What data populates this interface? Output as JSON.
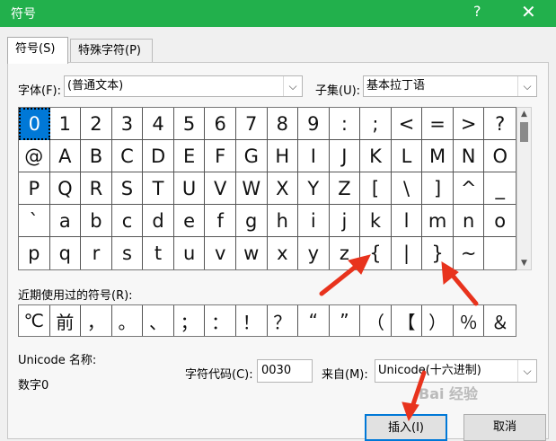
{
  "window": {
    "title": "符号",
    "help": "?",
    "close": "✕"
  },
  "tabs": [
    {
      "label": "符号(S)"
    },
    {
      "label": "特殊字符(P)"
    }
  ],
  "font": {
    "label": "字体(F):",
    "value": "(普通文本)"
  },
  "subset": {
    "label": "子集(U):",
    "value": "基本拉丁语"
  },
  "symbols": [
    "0",
    "1",
    "2",
    "3",
    "4",
    "5",
    "6",
    "7",
    "8",
    "9",
    ":",
    ";",
    "<",
    "=",
    ">",
    "?",
    "@",
    "A",
    "B",
    "C",
    "D",
    "E",
    "F",
    "G",
    "H",
    "I",
    "J",
    "K",
    "L",
    "M",
    "N",
    "O",
    "P",
    "Q",
    "R",
    "S",
    "T",
    "U",
    "V",
    "W",
    "X",
    "Y",
    "Z",
    "[",
    "\\",
    "]",
    "^",
    "_",
    "`",
    "a",
    "b",
    "c",
    "d",
    "e",
    "f",
    "g",
    "h",
    "i",
    "j",
    "k",
    "l",
    "m",
    "n",
    "o",
    "p",
    "q",
    "r",
    "s",
    "t",
    "u",
    "v",
    "w",
    "x",
    "y",
    "z",
    "{",
    "|",
    "}",
    "~",
    ""
  ],
  "selected_index": 0,
  "recent": {
    "label": "近期使用过的符号(R):",
    "items": [
      "℃",
      "前",
      "，",
      "。",
      "、",
      "；",
      "：",
      "！",
      "？",
      "“",
      "”",
      "（",
      "【",
      "）",
      "％",
      "＆"
    ]
  },
  "unicode_name": {
    "label": "Unicode 名称:",
    "value": "数字0"
  },
  "char_code": {
    "label": "字符代码(C):",
    "value": "0030"
  },
  "from": {
    "label": "来自(M):",
    "value": "Unicode(十六进制)"
  },
  "buttons": {
    "insert": "插入(I)",
    "cancel": "取消"
  },
  "watermark": "Bai 经验",
  "accent_color": "#22b04c",
  "arrow_color": "#e8331d"
}
